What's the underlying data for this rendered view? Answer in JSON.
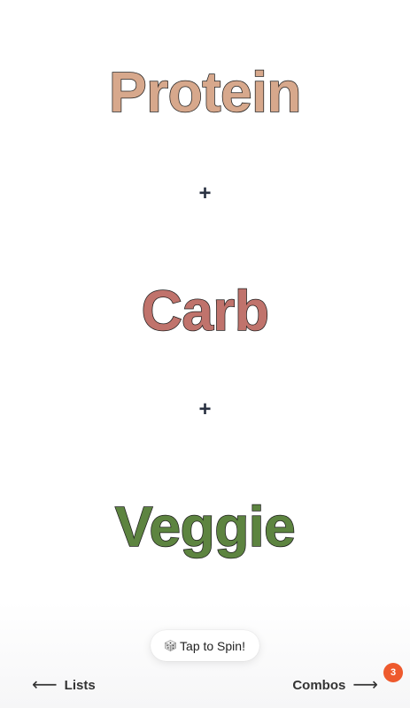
{
  "words": {
    "protein": "Protein",
    "carb": "Carb",
    "veggie": "Veggie"
  },
  "separators": {
    "first": "+",
    "second": "+"
  },
  "spin_button": {
    "icon": "dice-icon",
    "label": "Tap to Spin!"
  },
  "nav": {
    "lists_label": "Lists",
    "lists_arrow": "⟵",
    "combos_label": "Combos",
    "combos_arrow": "⟶",
    "combos_badge": "3"
  },
  "colors": {
    "protein": "#d7a88c",
    "carb": "#c0736c",
    "veggie": "#5d8440",
    "plus": "#2a3242",
    "badge": "#ee5a2d"
  }
}
